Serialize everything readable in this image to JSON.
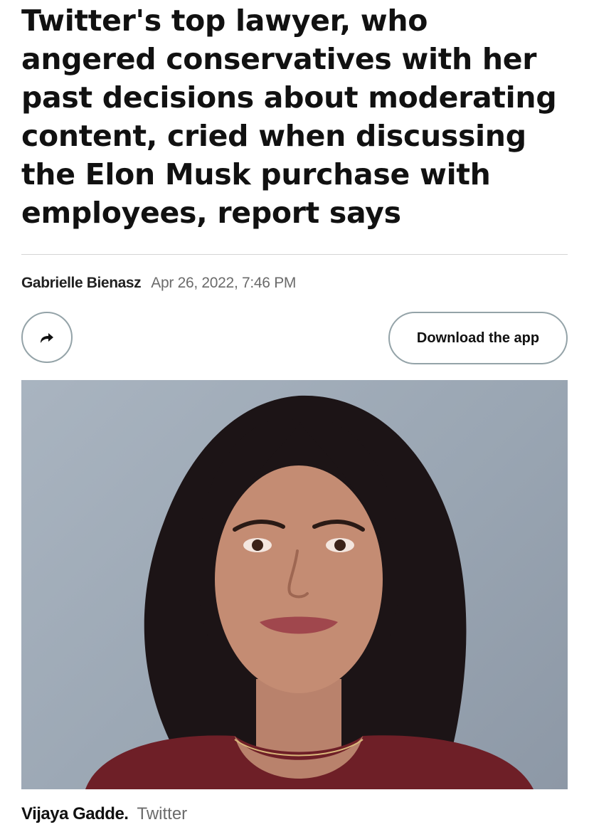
{
  "article": {
    "headline": "Twitter's top lawyer, who angered conservatives with her past decisions about moderating content, cried when discussing the Elon Musk purchase with employees, report says",
    "author": "Gabrielle Bienasz",
    "date": "Apr 26, 2022, 7:46 PM"
  },
  "actions": {
    "share_icon": "share-arrow-icon",
    "download_label": "Download the app"
  },
  "photo": {
    "caption_name": "Vijaya Gadde.",
    "caption_credit": "Twitter"
  }
}
